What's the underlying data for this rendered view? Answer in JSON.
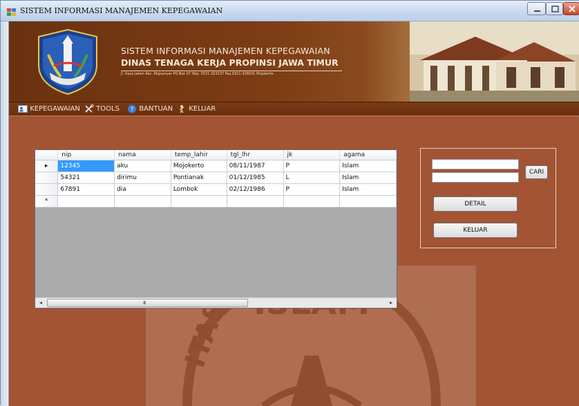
{
  "window": {
    "title": "SISTEM INFORMASI MANAJEMEN KEPEGAWAIAN"
  },
  "banner": {
    "title": "SISTEM INFORMASI MANAJEMEN KEPEGAWAIAN",
    "subtitle": "DINAS TENAGA KERJA PROPINSI JAWA TIMUR",
    "address": "Jl. Raya Jabon Kec. Mojoanyar PO.Box 07 Telp. 0321-323237 Fax.0321-328031 Mojokerto"
  },
  "menu": {
    "items": [
      {
        "label": "KEPEGAWAIAN",
        "icon": "user-card-icon"
      },
      {
        "label": "TOOLS",
        "icon": "tools-icon"
      },
      {
        "label": "BANTUAN",
        "icon": "help-icon"
      },
      {
        "label": "KELUAR",
        "icon": "exit-icon"
      }
    ]
  },
  "grid": {
    "columns": [
      "nip",
      "nama",
      "temp_lahir",
      "tgl_lhr",
      "jk",
      "agama"
    ],
    "rows": [
      {
        "marker": "▸",
        "cells": [
          "12345",
          "aku",
          "Mojokerto",
          "08/11/1987",
          "P",
          "Islam"
        ]
      },
      {
        "marker": "",
        "cells": [
          "54321",
          "dirimu",
          "Pontianak",
          "01/12/1985",
          "L",
          "Islam"
        ]
      },
      {
        "marker": "",
        "cells": [
          "67891",
          "dia",
          "Lombok",
          "02/12/1986",
          "P",
          "Islam"
        ]
      }
    ],
    "new_row_marker": "*",
    "scroll_grip": "III"
  },
  "panel": {
    "search_value_1": "",
    "search_value_2": "",
    "cari_label": "CARI",
    "detail_label": "DETAIL",
    "keluar_label": "KELUAR"
  },
  "watermark": {
    "text": "ISLAM",
    "side_letters": "ITAS"
  },
  "colors": {
    "background": "#a35434",
    "menubar": "#6a2f0f",
    "selection": "#3399ff"
  }
}
